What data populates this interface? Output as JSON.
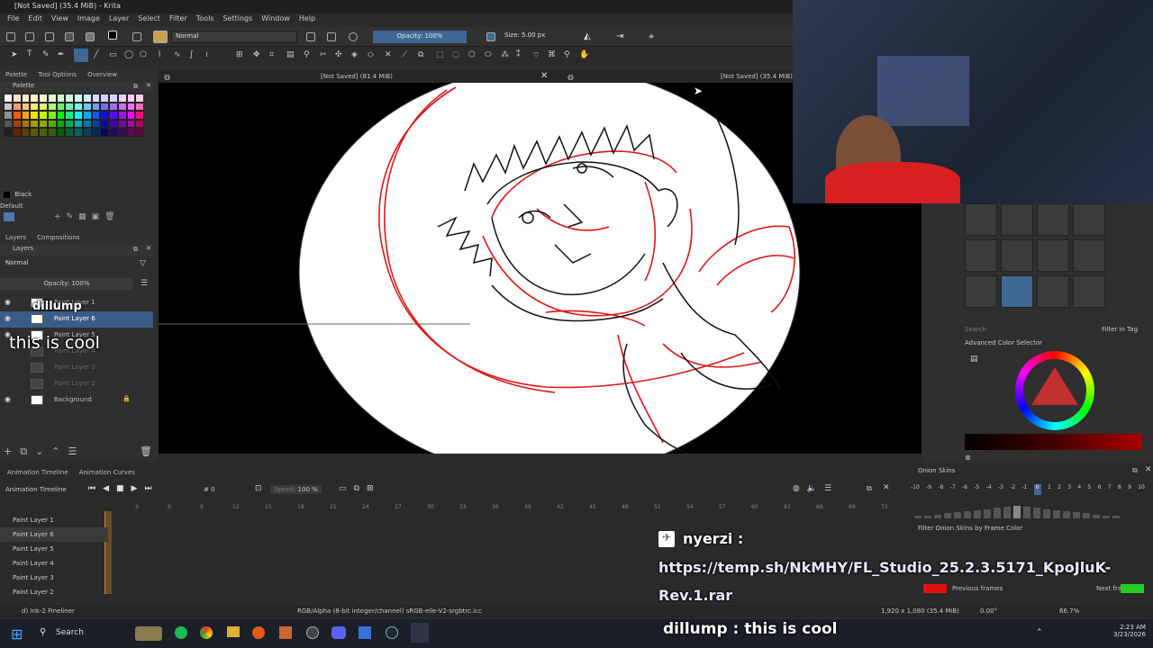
{
  "window": {
    "title": "[Not Saved] (35.4 MiB) - Krita"
  },
  "menu": [
    "File",
    "Edit",
    "View",
    "Image",
    "Layer",
    "Select",
    "Filter",
    "Tools",
    "Settings",
    "Window",
    "Help"
  ],
  "toolbar": {
    "blend_mode": "Normal",
    "opacity_label": "Opacity: 100%",
    "size_label": "Size: 5.00 px"
  },
  "doc_tabs": {
    "tab1": "[Not Saved]  (81.4 MiB)",
    "tab2": "[Not Saved]  (35.4 MiB)"
  },
  "left_dock": {
    "tabs": [
      "Palette",
      "Tool Options",
      "Overview"
    ],
    "palette_title": "Palette",
    "current_color": "Black",
    "palette_name": "Default",
    "layer_tabs": [
      "Layers",
      "Compositions"
    ],
    "layers_title": "Layers",
    "blend_mode": "Normal",
    "opacity_label": "Opacity:  100%",
    "layers": [
      "Paint Layer 1",
      "Paint Layer 6",
      "Paint Layer 5",
      "Paint Layer 4",
      "Paint Layer 3",
      "Paint Layer 2",
      "Background"
    ]
  },
  "overlay_chat_left": {
    "user": "dillump",
    "message": "this is cool"
  },
  "right_panel": {
    "search_placeholder": "Search",
    "filter_tag_label": "Filter in Tag",
    "color_selector_title": "Advanced Color Selector"
  },
  "timeline": {
    "tabs": [
      "Animation Timeline",
      "Animation Curves"
    ],
    "title": "Animation Timeline",
    "frame_value": "0",
    "speed_label": "Speed:",
    "speed_value": "100 %",
    "frame_numbers": [
      "3",
      "6",
      "9",
      "12",
      "15",
      "18",
      "21",
      "24",
      "27",
      "30",
      "33",
      "36",
      "39",
      "42",
      "45",
      "48",
      "51",
      "54",
      "57",
      "60",
      "63",
      "66",
      "69",
      "72"
    ],
    "layers": [
      "Paint Layer 1",
      "Paint Layer 6",
      "Paint Layer 5",
      "Paint Layer 4",
      "Paint Layer 3",
      "Paint Layer 2"
    ]
  },
  "onion": {
    "title": "Onion Skins",
    "numbers": [
      "-10",
      "-9",
      "-8",
      "-7",
      "-6",
      "-5",
      "-4",
      "-3",
      "-2",
      "-1",
      "0",
      "1",
      "2",
      "3",
      "4",
      "5",
      "6",
      "7",
      "8",
      "9",
      "10"
    ],
    "filter_label": "Filter Onion Skins by Frame Color",
    "prev_label": "Previous frames",
    "next_label": "Next frames",
    "prev_color": "#e01010",
    "next_color": "#22cc22"
  },
  "chat_overlay": {
    "user1": "nyerzi",
    "link": "https://temp.sh/NkMHY/FL_Studio_25.2.3.5171_KpoJIuK-Rev.1.rar",
    "link_line1": "https://temp.sh/NkMHY/FL_Studio_25.2.3.5171_KpoJluK-",
    "link_line2": "Rev.1.rar",
    "user2": "dillump",
    "message2": "this is cool"
  },
  "status": {
    "brush": "d) Ink-2 Fineliner",
    "color_space": "RGB/Alpha (8-bit integer/channel)  sRGB-elle-V2-srgbtrc.icc",
    "dimensions": "1,920 x 1,080 (35.4 MiB)",
    "rotation": "0.00°",
    "zoom": "66.7%"
  },
  "taskbar": {
    "search": "Search",
    "time": "2:23 AM",
    "date": "3/23/2026"
  },
  "colors": {
    "accent": "#3f6894",
    "sketch_red": "#e01818",
    "sketch_black": "#111111"
  }
}
